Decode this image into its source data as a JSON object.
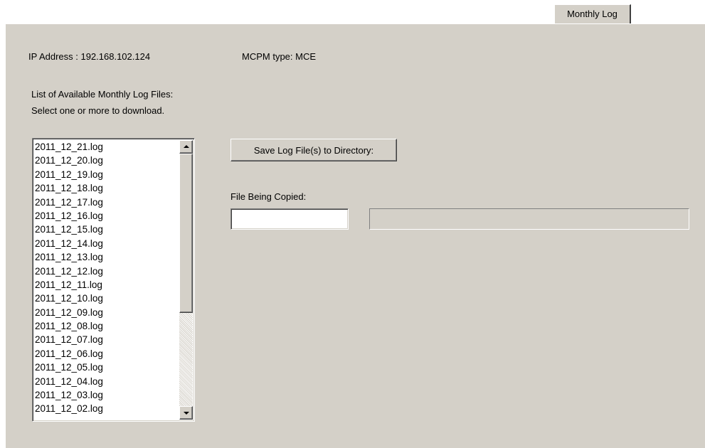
{
  "tab": {
    "label": "Monthly Log"
  },
  "info": {
    "ip_address": "IP Address : 192.168.102.124",
    "mcpm_type": "MCPM type: MCE"
  },
  "list": {
    "heading": "List of Available Monthly Log Files:",
    "instruction": "Select one or more to download.",
    "items": [
      "2011_12_21.log",
      "2011_12_20.log",
      "2011_12_19.log",
      "2011_12_18.log",
      "2011_12_17.log",
      "2011_12_16.log",
      "2011_12_15.log",
      "2011_12_14.log",
      "2011_12_13.log",
      "2011_12_12.log",
      "2011_12_11.log",
      "2011_12_10.log",
      "2011_12_09.log",
      "2011_12_08.log",
      "2011_12_07.log",
      "2011_12_06.log",
      "2011_12_05.log",
      "2011_12_04.log",
      "2011_12_03.log",
      "2011_12_02.log"
    ]
  },
  "actions": {
    "save_label": "Save Log File(s) to Directory:"
  },
  "copy": {
    "label": "File Being Copied:",
    "current_file": "",
    "progress": 0
  },
  "colors": {
    "panel_bg": "#d4d0c8",
    "progress_fill": "#0a246a"
  }
}
